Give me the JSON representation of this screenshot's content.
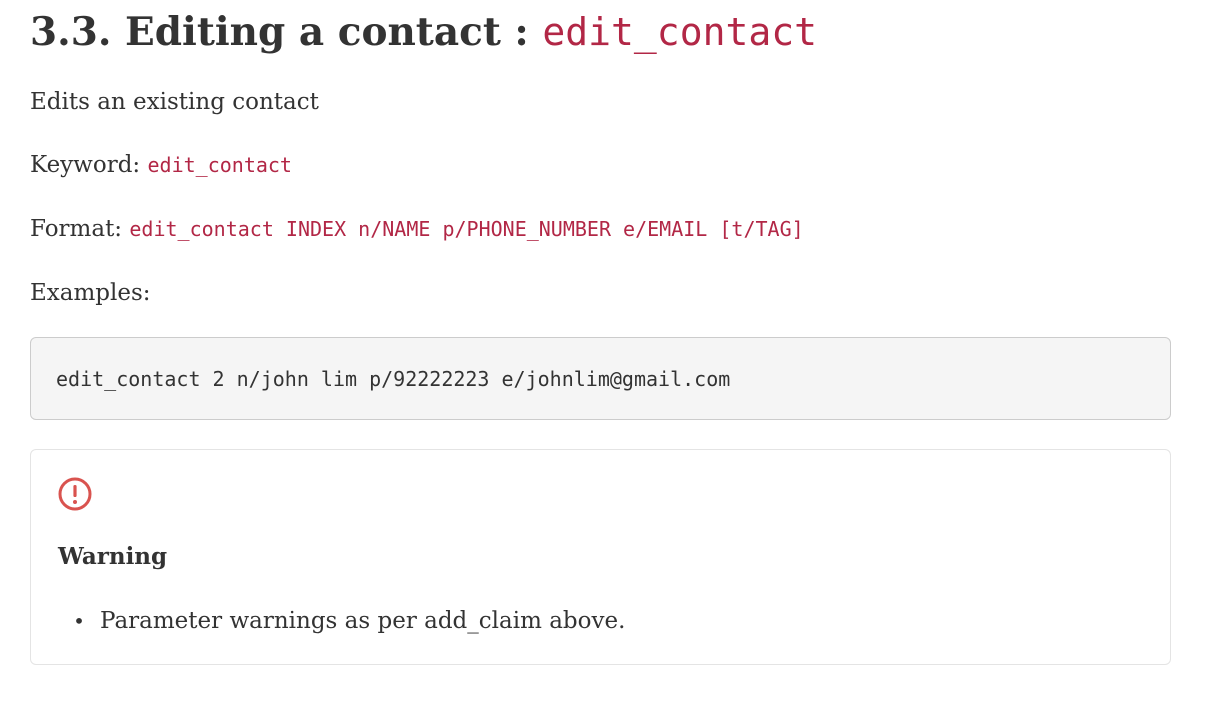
{
  "heading": {
    "text": "3.3. Editing a contact : ",
    "code": "edit_contact"
  },
  "description": "Edits an existing contact",
  "keyword": {
    "label": "Keyword: ",
    "code": "edit_contact"
  },
  "format": {
    "label": "Format: ",
    "code": "edit_contact INDEX n/NAME p/PHONE_NUMBER e/EMAIL [t/TAG]"
  },
  "examples_label": "Examples:",
  "example_code": "edit_contact 2 n/john lim p/92222223 e/johnlim@gmail.com",
  "warning": {
    "icon": "exclamation-circle-icon",
    "icon_color": "#d9534f",
    "title": "Warning",
    "items": [
      "Parameter warnings as per add_claim above."
    ]
  },
  "colors": {
    "code_accent": "#b22746",
    "text": "#333333",
    "code_block_bg": "#f5f5f5"
  }
}
